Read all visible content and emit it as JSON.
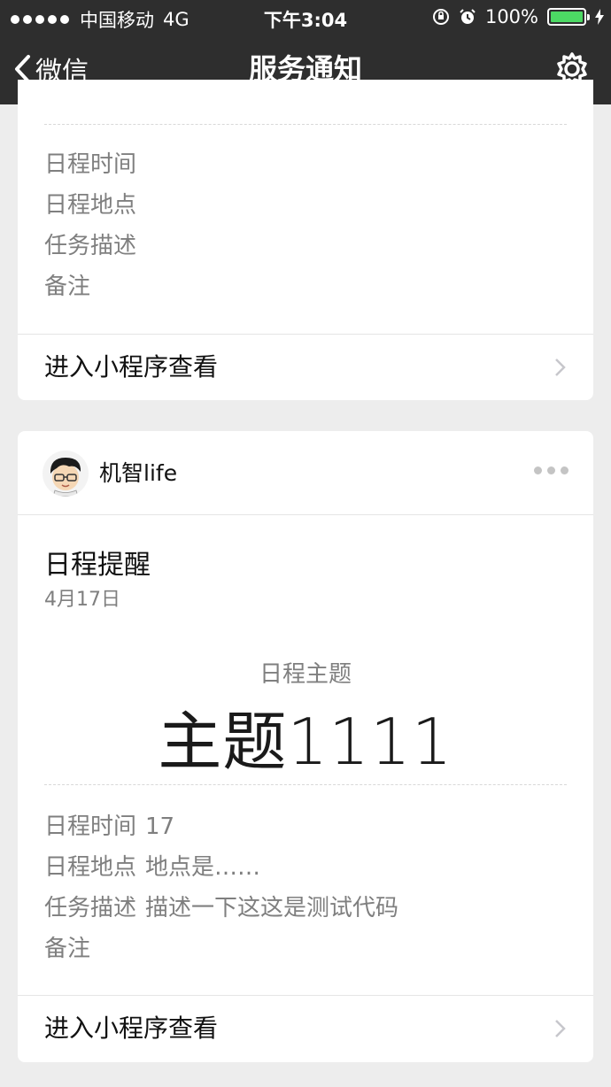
{
  "status_bar": {
    "carrier": "中国移动",
    "network": "4G",
    "time": "下午3:04",
    "battery": "100%",
    "battery_level": 1.0
  },
  "nav": {
    "back_label": "微信",
    "title": "服务通知",
    "settings_icon": "gear-icon"
  },
  "card1": {
    "fields": [
      {
        "label": "日程时间"
      },
      {
        "label": "日程地点"
      },
      {
        "label": "任务描述"
      },
      {
        "label": "备注"
      }
    ],
    "action_label": "进入小程序查看"
  },
  "card2": {
    "app_name": "机智life",
    "title": "日程提醒",
    "date": "4月17日",
    "topic_label": "日程主题",
    "topic_value": "主题1111",
    "fields": [
      {
        "label": "日程时间",
        "value": "17"
      },
      {
        "label": "日程地点",
        "value": "地点是……"
      },
      {
        "label": "任务描述",
        "value": "描述一下这这是测试代码"
      },
      {
        "label": "备注",
        "value": ""
      }
    ],
    "action_label": "进入小程序查看"
  },
  "colors": {
    "bar_background": "#2e2e2e",
    "page_background": "#ededed",
    "battery_fill": "#4cd964"
  }
}
